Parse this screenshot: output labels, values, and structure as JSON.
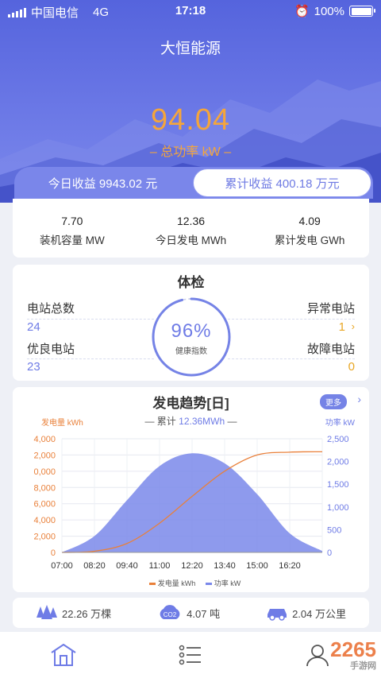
{
  "status_bar": {
    "carrier": "中国电信",
    "network": "4G",
    "time": "17:18",
    "battery": "100%"
  },
  "app_title": "大恒能源",
  "total_power": {
    "value": "94.04",
    "label": "– 总功率 kW –"
  },
  "revenue_tabs": [
    {
      "label": "今日收益 9943.02 元",
      "active": true
    },
    {
      "label": "累计收益 400.18 万元",
      "active": false
    }
  ],
  "stats": [
    {
      "value": "7.70",
      "label": "装机容量 MW"
    },
    {
      "value": "12.36",
      "label": "今日发电 MWh"
    },
    {
      "value": "4.09",
      "label": "累计发电 GWh"
    }
  ],
  "health": {
    "title": "体检",
    "total_label": "电站总数",
    "total_value": "24",
    "good_label": "优良电站",
    "good_value": "23",
    "abnormal_label": "异常电站",
    "abnormal_value": "1",
    "fault_label": "故障电站",
    "fault_value": "0",
    "gauge_percent": "96%",
    "gauge_label": "健康指数",
    "gauge_fraction": 0.96
  },
  "trend": {
    "title": "发电趋势[日]",
    "more_label": "更多",
    "cumulative_prefix": "累计",
    "cumulative_value": "12.36MWh",
    "left_axis_label": "发电量 kWh",
    "right_axis_label": "功率 kW",
    "legend": [
      {
        "name": "发电量 kWh",
        "color": "#e9803a"
      },
      {
        "name": "功率 kW",
        "color": "#7a88ea"
      }
    ]
  },
  "chart_data": {
    "type": "area",
    "x": [
      "07:00",
      "08:20",
      "09:40",
      "11:00",
      "12:20",
      "13:40",
      "15:00",
      "16:20"
    ],
    "left_axis_ticks": [
      "4,000",
      "2,000",
      "0,000",
      "8,000",
      "6,000",
      "4,000",
      "2,000",
      "0"
    ],
    "right_axis_ticks": [
      "2,500",
      "2,000",
      "1,500",
      "1,000",
      "500",
      "0"
    ],
    "series": [
      {
        "name": "功率 kW",
        "axis": "right",
        "values": [
          0,
          360,
          1150,
          1900,
          2180,
          1960,
          1280,
          420,
          30
        ]
      },
      {
        "name": "发电量 kWh",
        "axis": "left",
        "values": [
          0,
          150,
          1100,
          3600,
          6900,
          10000,
          12000,
          12350,
          12400
        ]
      }
    ],
    "x_values_min": [
      420,
      500,
      580,
      660,
      740,
      820,
      900,
      980,
      1060
    ],
    "left_ylim": [
      0,
      14000
    ],
    "right_ylim": [
      0,
      2500
    ],
    "grid": true,
    "legend_position": "bottom"
  },
  "environment": [
    {
      "icon": "tree-icon",
      "text": "22.26 万棵"
    },
    {
      "icon": "co2-icon",
      "text": "4.07 吨"
    },
    {
      "icon": "car-icon",
      "text": "2.04 万公里"
    }
  ],
  "watermark": {
    "text": "2265",
    "sub": "手游网"
  },
  "colors": {
    "primary": "#5a67df",
    "accent": "#f4a53c",
    "area": "#7a88ea",
    "line": "#e9803a"
  }
}
